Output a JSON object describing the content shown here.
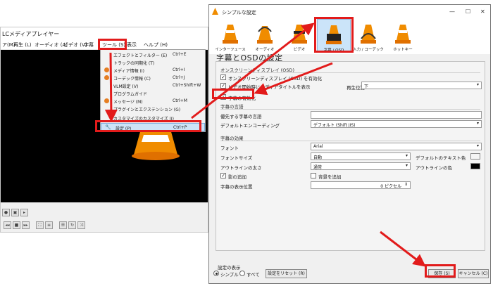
{
  "vlc": {
    "title": "LCメディアプレイヤー",
    "menu": [
      "ア(M)",
      "再生 (L)",
      "オーディオ (A)",
      "ビデオ (V)",
      "字幕",
      "ツール (S)",
      "表示",
      "ヘルプ (H)"
    ]
  },
  "tools_menu": {
    "items": [
      {
        "label": "エフェクトとフィルター (E)",
        "shortcut": "Ctrl+E"
      },
      {
        "label": "トラックの同期化 (T)",
        "shortcut": ""
      },
      {
        "label": "メディア情報 (I)",
        "shortcut": "Ctrl+I"
      },
      {
        "label": "コーデック情報 (C)",
        "shortcut": "Ctrl+J"
      },
      {
        "label": "VLM設定 (V)",
        "shortcut": "Ctrl+Shift+W"
      },
      {
        "label": "プログラムガイド",
        "shortcut": ""
      },
      {
        "label": "メッセージ (M)",
        "shortcut": "Ctrl+M"
      },
      {
        "label": "プラグインとエクステンション (G)",
        "shortcut": ""
      },
      {
        "label": "カスタマイズのカスタマイズ (I)",
        "shortcut": ""
      },
      {
        "label": "設定 (P)",
        "shortcut": "Ctrl+P"
      }
    ]
  },
  "dialog": {
    "title": "シンプルな設定",
    "tabs": [
      "インターフェース",
      "オーディオ",
      "ビデオ",
      "字幕 / OSD",
      "入力 / コーデック",
      "ホットキー"
    ],
    "heading": "字幕とOSDの設定",
    "osd_group": "オンスクリーンディスプレイ (OSD)",
    "osd_enable": "オンスクリーンディスプレイ (OSD) を有効化",
    "show_title": "ビデオ開始時にメディアタイトルを表示",
    "play_position_label": "再生位置",
    "play_position_value": "下",
    "subtitle_enable": "字幕の有効化",
    "lang_group": "字幕の言語",
    "preferred_lang_label": "優先する字幕の言語",
    "encoding_label": "デフォルトエンコーディング",
    "encoding_value": "デフォルト (Shift JIS)",
    "effects_group": "字幕の効果",
    "font_label": "フォント",
    "font_value": "Arial",
    "fontsize_label": "フォントサイズ",
    "fontsize_value": "自動",
    "default_text_color_label": "デフォルトのテキスト色",
    "outline_thickness_label": "アウトラインの太さ",
    "outline_thickness_value": "通常",
    "outline_color_label": "アウトラインの色",
    "shadow_label": "影の追加",
    "background_label": "背景を追加",
    "position_label": "字幕の表示位置",
    "position_value": "0 ピクセル",
    "show_settings_label": "設定の表示",
    "simple_label": "シンプル",
    "all_label": "すべて",
    "reset_button": "設定をリセット (R)",
    "save_button": "保存 (S)",
    "cancel_button": "キャンセル (C)"
  },
  "colors": {
    "accent_red": "#e21b1b",
    "selection": "#cbe4f9",
    "vlc_orange": "#f08c00"
  }
}
